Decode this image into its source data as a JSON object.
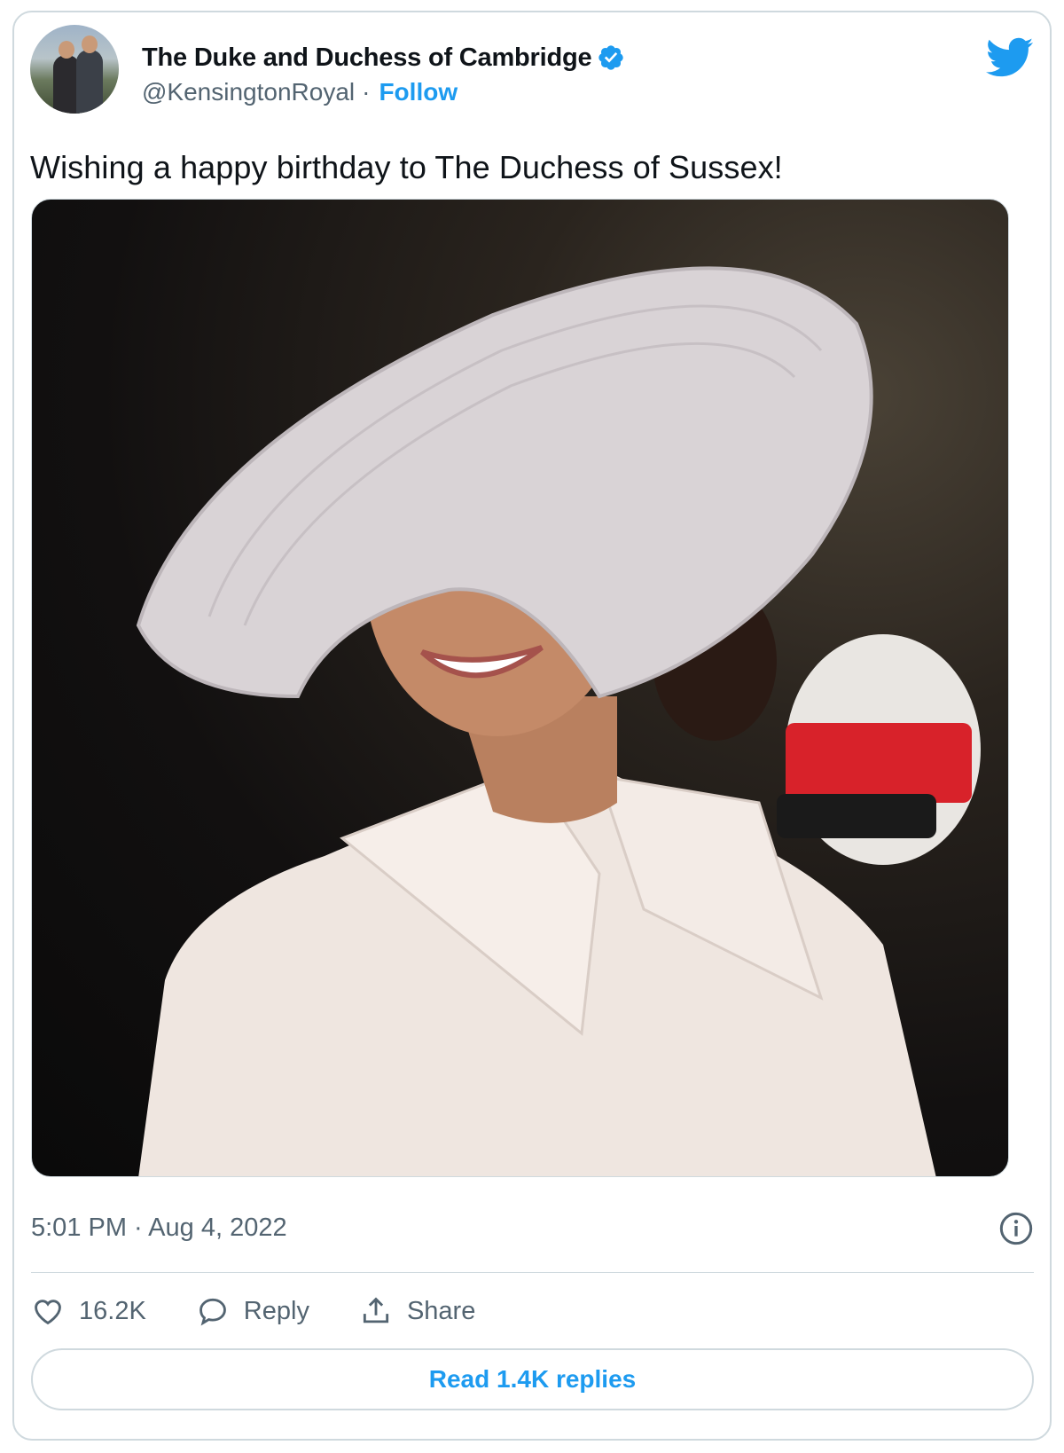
{
  "tweet": {
    "author": {
      "display_name": "The Duke and Duchess of Cambridge",
      "handle": "@KensingtonRoyal",
      "separator": "·",
      "follow_label": "Follow",
      "verified_icon": "verified-badge-icon",
      "avatar_icon": "avatar"
    },
    "brand_icon": "twitter-bird-icon",
    "text": "Wishing a happy birthday to The Duchess of Sussex!",
    "timestamp": "5:01 PM · Aug 4, 2022",
    "actions": {
      "like_count": "16.2K",
      "reply_label": "Reply",
      "share_label": "Share"
    },
    "read_replies_label": "Read 1.4K replies"
  },
  "colors": {
    "accent": "#1d9bf0",
    "text_primary": "#0f1419",
    "text_secondary": "#536471",
    "border": "#cfd9de"
  }
}
